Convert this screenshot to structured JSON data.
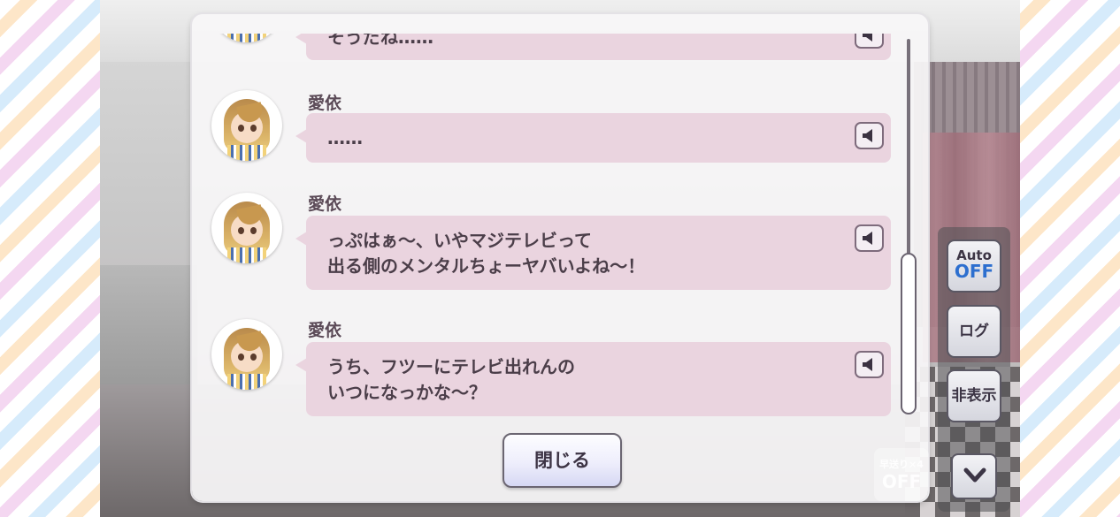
{
  "log": {
    "entries": [
      {
        "speaker": "",
        "lines": [
          "そうだね……"
        ]
      },
      {
        "speaker": "愛依",
        "lines": [
          "……"
        ]
      },
      {
        "speaker": "愛依",
        "lines": [
          "っぷはぁ～、いやマジテレビって",
          "出る側のメンタルちょーヤバいよね～！"
        ]
      },
      {
        "speaker": "愛依",
        "lines": [
          "うち、フツーにテレビ出れんの",
          "いつになっかな～？"
        ]
      }
    ],
    "close_label": "閉じる"
  },
  "controls": {
    "auto_label": "Auto",
    "auto_state": "OFF",
    "log_label": "ログ",
    "hide_label": "非表示",
    "speed_label": "早送り×4",
    "speed_state": "OFF",
    "down_icon": "chevron-down-icon"
  },
  "colors": {
    "bubble": "#ead4df",
    "auto_state": "#2d6fcf",
    "panel_text": "#3c3545"
  }
}
